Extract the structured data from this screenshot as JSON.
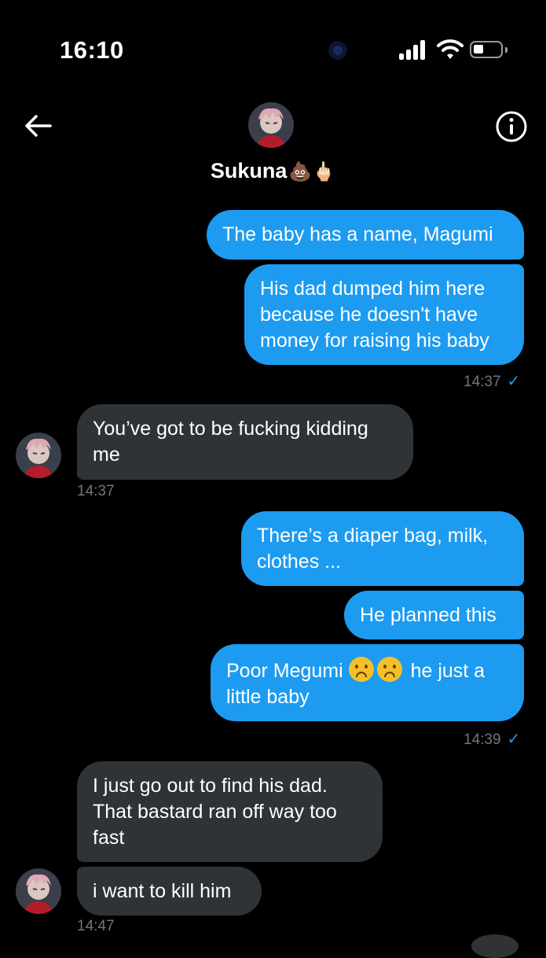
{
  "status_bar": {
    "time": "16:10"
  },
  "header": {
    "contact_name": "Sukuna",
    "name_emojis": "💩🖕🏻",
    "back_icon": "back-arrow-icon",
    "info_icon": "info-icon"
  },
  "messages": [
    {
      "direction": "sent",
      "text": "The baby has a name, Magumi"
    },
    {
      "direction": "sent",
      "text": "His dad dumped him here because he doesn't have money for raising his baby"
    },
    {
      "direction": "recv",
      "text": "You’ve got to be fucking kidding me"
    },
    {
      "direction": "sent",
      "text": "There’s a diaper bag, milk, clothes ..."
    },
    {
      "direction": "sent",
      "text": "He planned this"
    },
    {
      "direction": "sent",
      "text_before": "Poor Megumi",
      "emojis": "frowning-face frowning-face",
      "text_after": "he just a little baby"
    },
    {
      "direction": "recv",
      "text": "I just go out to find his dad. That bastard ran off way too fast"
    },
    {
      "direction": "recv",
      "text": "i want to kill him"
    }
  ],
  "timestamps": [
    "14:37",
    "14:37",
    "14:39",
    "14:47"
  ],
  "colors": {
    "sent_bubble": "#1d9bf0",
    "received_bubble": "#2f3336",
    "background": "#000000",
    "meta_text": "#71767b"
  }
}
